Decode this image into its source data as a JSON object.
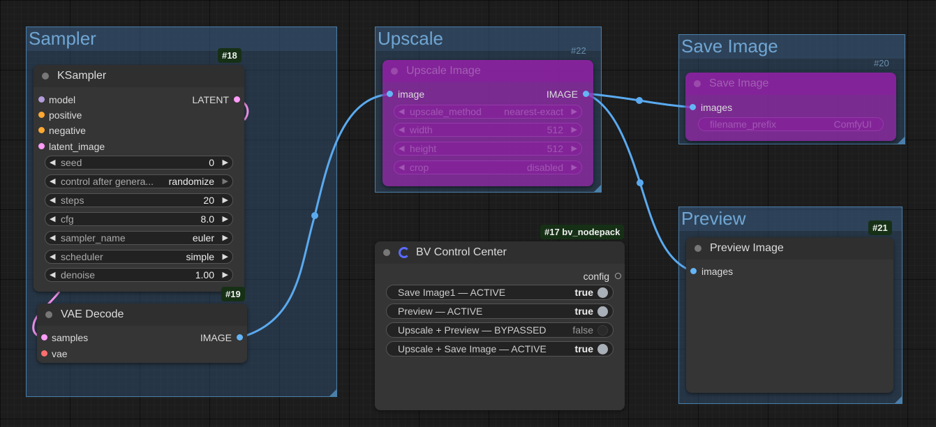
{
  "colors": {
    "link_image": "#5aaaf0",
    "link_latent": "#f090e8",
    "slot_model": "#b39ddb",
    "slot_cond": "#ffa931",
    "slot_latent": "#ff9cf9",
    "slot_image": "#64b5f6",
    "slot_vae": "#ff6e6e",
    "group": "#335577",
    "bypass": "#9628aa"
  },
  "groups": {
    "sampler": {
      "title": "Sampler"
    },
    "upscale": {
      "title": "Upscale"
    },
    "save": {
      "title": "Save Image"
    },
    "preview": {
      "title": "Preview"
    }
  },
  "ksampler": {
    "id": "#18",
    "title": "KSampler",
    "inputs": [
      "model",
      "positive",
      "negative",
      "latent_image"
    ],
    "output": "LATENT",
    "widgets": [
      {
        "label": "seed",
        "value": "0"
      },
      {
        "label": "control after genera...",
        "value": "randomize"
      },
      {
        "label": "steps",
        "value": "20"
      },
      {
        "label": "cfg",
        "value": "8.0"
      },
      {
        "label": "sampler_name",
        "value": "euler"
      },
      {
        "label": "scheduler",
        "value": "simple"
      },
      {
        "label": "denoise",
        "value": "1.00"
      }
    ]
  },
  "vae": {
    "id": "#19",
    "title": "VAE Decode",
    "inputs": [
      "samples",
      "vae"
    ],
    "output": "IMAGE"
  },
  "upscale_node": {
    "id": "#22",
    "title": "Upscale Image",
    "input": "image",
    "output": "IMAGE",
    "widgets": [
      {
        "label": "upscale_method",
        "value": "nearest-exact"
      },
      {
        "label": "width",
        "value": "512"
      },
      {
        "label": "height",
        "value": "512"
      },
      {
        "label": "crop",
        "value": "disabled"
      }
    ]
  },
  "save_node": {
    "id": "#20",
    "title": "Save Image",
    "input": "images",
    "widget": {
      "label": "filename_prefix",
      "value": "ComfyUI"
    }
  },
  "preview_node": {
    "id": "#21",
    "title": "Preview Image",
    "input": "images"
  },
  "bv": {
    "id": "#17 bv_nodepack",
    "title": "BV Control Center",
    "output": "config",
    "toggles": [
      {
        "label": "Save Image1 — ACTIVE",
        "value": "true"
      },
      {
        "label": "Preview — ACTIVE",
        "value": "true"
      },
      {
        "label": "Upscale + Preview — BYPASSED",
        "value": "false"
      },
      {
        "label": "Upscale + Save Image — ACTIVE",
        "value": "true"
      }
    ]
  }
}
